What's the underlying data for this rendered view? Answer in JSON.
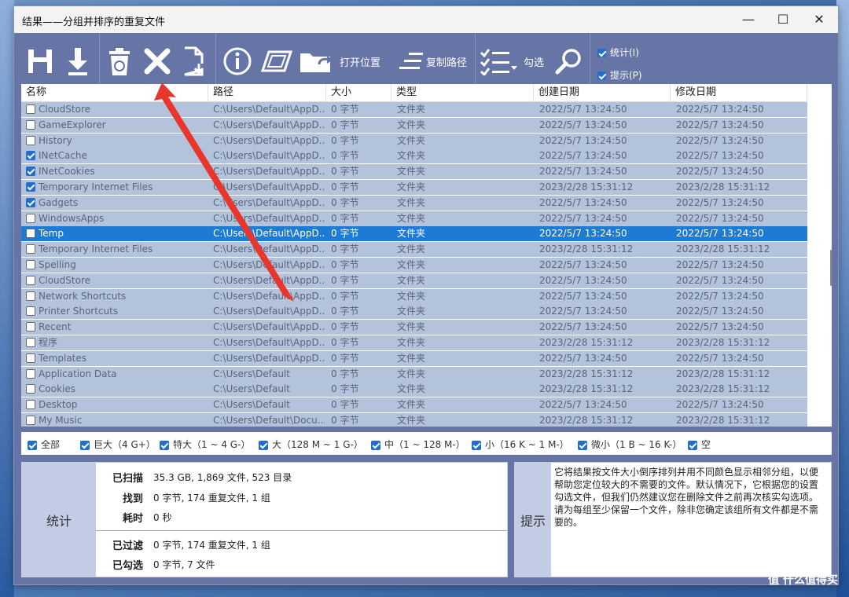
{
  "window": {
    "title": "结果——分组并排序的重复文件"
  },
  "toolbar": {
    "open_location_label": "打开位置",
    "copy_path_label": "复制路径",
    "check_label": "勾选",
    "stats_checkbox_label": "统计(I)",
    "hint_checkbox_label": "提示(P)"
  },
  "columns": [
    "名称",
    "路径",
    "大小",
    "类型",
    "创建日期",
    "修改日期"
  ],
  "rows": [
    {
      "checked": false,
      "name": "CloudStore",
      "path": "C:\\Users\\Default\\AppD...",
      "size": "0 字节",
      "type": "文件夹",
      "created": "2022/5/7 13:24:50",
      "modified": "2022/5/7 13:24:50"
    },
    {
      "checked": false,
      "name": "GameExplorer",
      "path": "C:\\Users\\Default\\AppD...",
      "size": "0 字节",
      "type": "文件夹",
      "created": "2022/5/7 13:24:50",
      "modified": "2022/5/7 13:24:50"
    },
    {
      "checked": false,
      "name": "History",
      "path": "C:\\Users\\Default\\AppD...",
      "size": "0 字节",
      "type": "文件夹",
      "created": "2022/5/7 13:24:50",
      "modified": "2022/5/7 13:24:50"
    },
    {
      "checked": true,
      "name": "INetCache",
      "path": "C:\\Users\\Default\\AppD...",
      "size": "0 字节",
      "type": "文件夹",
      "created": "2022/5/7 13:24:50",
      "modified": "2022/5/7 13:24:50"
    },
    {
      "checked": true,
      "name": "INetCookies",
      "path": "C:\\Users\\Default\\AppD...",
      "size": "0 字节",
      "type": "文件夹",
      "created": "2022/5/7 13:24:50",
      "modified": "2022/5/7 13:24:50"
    },
    {
      "checked": true,
      "name": "Temporary Internet Files",
      "path": "C:\\Users\\Default\\AppD...",
      "size": "0 字节",
      "type": "文件夹",
      "created": "2023/2/28 15:31:12",
      "modified": "2023/2/28 15:31:12"
    },
    {
      "checked": true,
      "name": "Gadgets",
      "path": "C:\\Users\\Default\\AppD...",
      "size": "0 字节",
      "type": "文件夹",
      "created": "2022/5/7 13:24:50",
      "modified": "2022/5/7 13:24:50"
    },
    {
      "checked": false,
      "name": "WindowsApps",
      "path": "C:\\Users\\Default\\AppD...",
      "size": "0 字节",
      "type": "文件夹",
      "created": "2022/5/7 13:24:50",
      "modified": "2022/5/7 13:24:50"
    },
    {
      "checked": false,
      "selected": true,
      "name": "Temp",
      "path": "C:\\Users\\Default\\AppD...",
      "size": "0 字节",
      "type": "文件夹",
      "created": "2022/5/7 13:24:50",
      "modified": "2022/5/7 13:24:50"
    },
    {
      "checked": false,
      "name": "Temporary Internet Files",
      "path": "C:\\Users\\Default\\AppD...",
      "size": "0 字节",
      "type": "文件夹",
      "created": "2023/2/28 15:31:12",
      "modified": "2023/2/28 15:31:12"
    },
    {
      "checked": false,
      "name": "Spelling",
      "path": "C:\\Users\\Default\\AppD...",
      "size": "0 字节",
      "type": "文件夹",
      "created": "2022/5/7 13:24:50",
      "modified": "2022/5/7 13:24:50"
    },
    {
      "checked": false,
      "name": "CloudStore",
      "path": "C:\\Users\\Default\\AppD...",
      "size": "0 字节",
      "type": "文件夹",
      "created": "2022/5/7 13:24:50",
      "modified": "2022/5/7 13:24:50"
    },
    {
      "checked": false,
      "name": "Network Shortcuts",
      "path": "C:\\Users\\Default\\AppD...",
      "size": "0 字节",
      "type": "文件夹",
      "created": "2022/5/7 13:24:50",
      "modified": "2022/5/7 13:24:50"
    },
    {
      "checked": false,
      "name": "Printer Shortcuts",
      "path": "C:\\Users\\Default\\AppD...",
      "size": "0 字节",
      "type": "文件夹",
      "created": "2022/5/7 13:24:50",
      "modified": "2022/5/7 13:24:50"
    },
    {
      "checked": false,
      "name": "Recent",
      "path": "C:\\Users\\Default\\AppD...",
      "size": "0 字节",
      "type": "文件夹",
      "created": "2022/5/7 13:24:50",
      "modified": "2022/5/7 13:24:50"
    },
    {
      "checked": false,
      "name": "程序",
      "path": "C:\\Users\\Default\\AppD...",
      "size": "0 字节",
      "type": "文件夹",
      "created": "2023/2/28 15:31:12",
      "modified": "2023/2/28 15:31:12"
    },
    {
      "checked": false,
      "name": "Templates",
      "path": "C:\\Users\\Default\\AppD...",
      "size": "0 字节",
      "type": "文件夹",
      "created": "2022/5/7 13:24:50",
      "modified": "2022/5/7 13:24:50"
    },
    {
      "checked": false,
      "name": "Application Data",
      "path": "C:\\Users\\Default",
      "size": "0 字节",
      "type": "文件夹",
      "created": "2023/2/28 15:31:12",
      "modified": "2023/2/28 15:31:12"
    },
    {
      "checked": false,
      "name": "Cookies",
      "path": "C:\\Users\\Default",
      "size": "0 字节",
      "type": "文件夹",
      "created": "2023/2/28 15:31:12",
      "modified": "2023/2/28 15:31:12"
    },
    {
      "checked": false,
      "name": "Desktop",
      "path": "C:\\Users\\Default",
      "size": "0 字节",
      "type": "文件夹",
      "created": "2022/5/7 13:24:50",
      "modified": "2022/5/7 13:24:50"
    },
    {
      "checked": false,
      "name": "My Music",
      "path": "C:\\Users\\Default\\Docu...",
      "size": "0 字节",
      "type": "文件夹",
      "created": "2023/2/28 15:31:12",
      "modified": "2023/2/28 15:31:12"
    }
  ],
  "filters": [
    {
      "label": "全部",
      "checked": true
    },
    {
      "label": "巨大（4 G+）",
      "checked": true
    },
    {
      "label": "特大（1 ~ 4 G-）",
      "checked": true
    },
    {
      "label": "大（128 M ~ 1 G-）",
      "checked": true
    },
    {
      "label": "中（1 ~ 128 M-）",
      "checked": true
    },
    {
      "label": "小（16 K ~ 1 M-）",
      "checked": true
    },
    {
      "label": "微小（1 B ~ 16 K-）",
      "checked": true
    },
    {
      "label": "空",
      "checked": true
    }
  ],
  "stats": {
    "label": "统计",
    "items": [
      {
        "key": "已扫描",
        "value": "35.3 GB, 1,869 文件, 523 目录"
      },
      {
        "key": "找到",
        "value": "0 字节, 174 重复文件, 1 组"
      },
      {
        "key": "耗时",
        "value": "0 秒"
      },
      {
        "key": "已过滤",
        "value": "0 字节, 174 重复文件, 1 组"
      },
      {
        "key": "已勾选",
        "value": "0 字节, 7 文件"
      }
    ]
  },
  "hint": {
    "label": "提示",
    "text": "它将结果按文件大小倒序排列并用不同颜色显示相邻分组，以便帮助您定位较大的不需要的文件。默认情况下，它根据您的设置勾选文件，但我们仍然建议您在删除文件之前再次核实勾选项。请为每组至少保留一个文件，除非您确定该组所有文件都是不需要的。"
  },
  "watermark": "值 什么值得买",
  "colors": {
    "toolbar_bg": "#6674a6",
    "row_bg": "#b3c3dc",
    "row_selected": "#1e7bd4",
    "arrow": "#e8362c"
  }
}
